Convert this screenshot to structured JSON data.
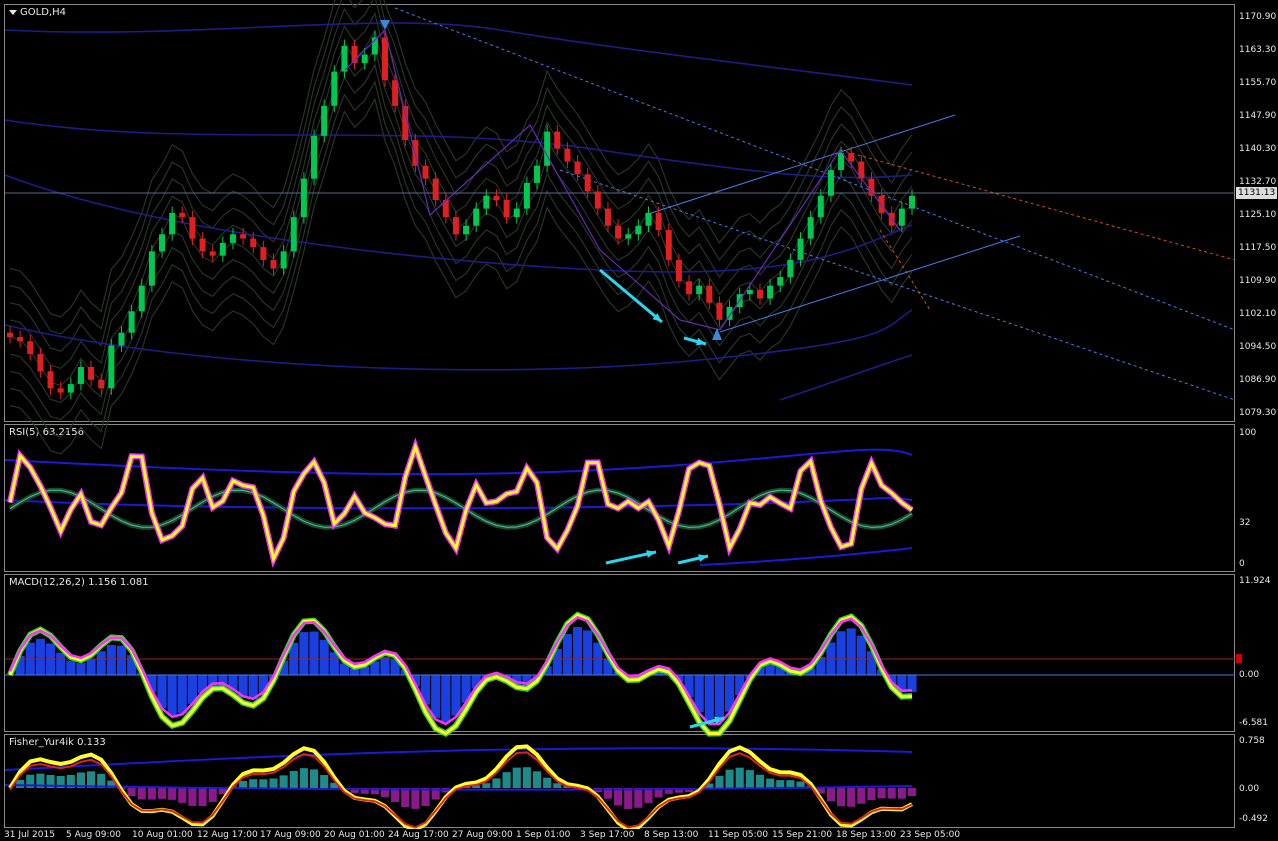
{
  "chart_data": [
    {
      "type": "candlestick",
      "title": "GOLD,H4",
      "y_ticks": [
        "1170.90",
        "1163.30",
        "1155.70",
        "1147.90",
        "1140.30",
        "1132.70",
        "1125.10",
        "1117.50",
        "1109.90",
        "1102.10",
        "1094.50",
        "1086.90",
        "1079.30"
      ],
      "ylim": [
        1079.3,
        1170.9
      ],
      "current_price": "1131.13",
      "close_approx": [
        1098,
        1097,
        1094,
        1090,
        1086,
        1085,
        1087,
        1091,
        1088,
        1086,
        1096,
        1099,
        1104,
        1110,
        1118,
        1122,
        1127,
        1126,
        1121,
        1118,
        1117,
        1120,
        1122,
        1121,
        1119,
        1116,
        1114,
        1118,
        1126,
        1135,
        1145,
        1152,
        1160,
        1166,
        1162,
        1164,
        1168,
        1158,
        1152,
        1144,
        1138,
        1135,
        1130,
        1126,
        1122,
        1124,
        1128,
        1131,
        1130,
        1126,
        1128,
        1134,
        1138,
        1146,
        1142,
        1139,
        1136,
        1132,
        1128,
        1124,
        1121,
        1122,
        1124,
        1127,
        1123,
        1116,
        1111,
        1108,
        1110,
        1106,
        1102,
        1105,
        1108,
        1109,
        1107,
        1110,
        1112,
        1116,
        1121,
        1126,
        1131,
        1137,
        1141,
        1139,
        1135,
        1131,
        1127,
        1124,
        1128,
        1131
      ]
    },
    {
      "type": "line",
      "title": "RSI(5) 63.2156",
      "y_ticks": [
        "100",
        "32",
        "0"
      ],
      "ylim": [
        0,
        100
      ]
    },
    {
      "type": "line",
      "title": "MACD(12,26,2) 1.156 1.081",
      "y_ticks": [
        "11.924",
        "0.00",
        "-6.581"
      ],
      "ylim": [
        -6.581,
        11.924
      ]
    },
    {
      "type": "line",
      "title": "Fisher_Yur4ik 0.133",
      "y_ticks": [
        "0.758",
        "0.00",
        "-0.492"
      ],
      "ylim": [
        -0.492,
        0.758
      ]
    }
  ],
  "time_axis": [
    "31 Jul 2015",
    "5 Aug 09:00",
    "10 Aug 01:00",
    "12 Aug 17:00",
    "17 Aug 09:00",
    "20 Aug 01:00",
    "24 Aug 17:00",
    "27 Aug 09:00",
    "1 Sep 01:00",
    "3 Sep 17:00",
    "8 Sep 13:00",
    "11 Sep 05:00",
    "15 Sep 21:00",
    "18 Sep 13:00",
    "23 Sep 05:00"
  ],
  "colors": {
    "bull": "#00c850",
    "bear": "#e02020",
    "bands": "#2a3a2a",
    "ma": "#1c1c8a",
    "channel": "#4a7ae8",
    "arrow": "#28d8f0",
    "rsi": "#ffff20",
    "rsi_glow": "#ff30ff",
    "macd_hist": "#1a40e0",
    "fisher_pos": "#1e8a8a",
    "fisher_neg": "#8a1a8a"
  }
}
